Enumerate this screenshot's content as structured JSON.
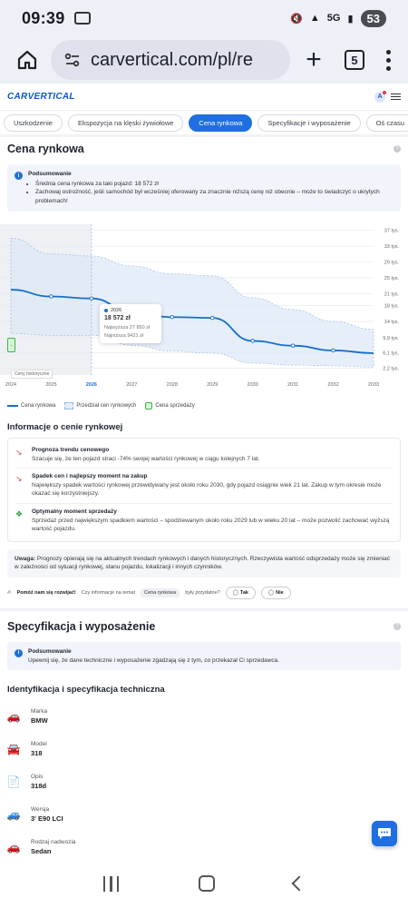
{
  "status_bar": {
    "time": "09:39",
    "network": "5G",
    "battery": "53"
  },
  "browser": {
    "url": "carvertical.com/pl/re",
    "tab_count": "5"
  },
  "site": {
    "logo_main": "CARVERTICAL",
    "avatar_initial": "A"
  },
  "tabs": [
    {
      "label": "Uszkodzenie",
      "active": false
    },
    {
      "label": "Ekspozycja na klęski żywiołowe",
      "active": false
    },
    {
      "label": "Cena rynkowa",
      "active": true
    },
    {
      "label": "Specyfikacje i wyposażenie",
      "active": false
    },
    {
      "label": "Oś czasu",
      "active": false
    }
  ],
  "market_price": {
    "title": "Cena rynkowa",
    "summary_title": "Podsumowanie",
    "summary_items": [
      "Średnia cena rynkowa za taki pojazd: 18 572 zł",
      "Zachowaj ostrożność, jeśli samochód był wcześniej oferowany za znacznie niższą cenę niż obecnie – może to świadczyć o ukrytych problemach!"
    ]
  },
  "chart_data": {
    "type": "line",
    "x": [
      2024,
      2025,
      2026,
      2027,
      2028,
      2029,
      2030,
      2031,
      2032,
      2033
    ],
    "x_ticks": [
      "2024",
      "2025",
      "2026",
      "2027",
      "2028",
      "2029",
      "2030",
      "2031",
      "2032",
      "2033"
    ],
    "y_ticks": [
      "37 tys.",
      "33 tys.",
      "29 tys.",
      "25 tys.",
      "21 tys.",
      "18 tys.",
      "14 tys.",
      "9,9 tys.",
      "6,1 tys.",
      "2,2 tys."
    ],
    "y_tick_values": [
      37,
      33,
      29,
      25,
      21,
      18,
      14,
      9.9,
      6.1,
      2.2
    ],
    "ylim": [
      0.5,
      38.5
    ],
    "series": [
      {
        "name": "Cena rynkowa",
        "values": [
          22,
          20.3,
          19.8,
          16.4,
          15.1,
          14.9,
          9.1,
          7.9,
          6.7,
          6.0
        ]
      }
    ],
    "band_upper": [
      35,
      31,
      30.5,
      28,
      26,
      25.5,
      20,
      17,
      14,
      12
    ],
    "band_lower": [
      11,
      10.5,
      10.5,
      8,
      6.5,
      6,
      3.5,
      3,
      2.8,
      2.5
    ],
    "highlight": {
      "year": "2026",
      "price": "18 572 zł",
      "max": "Najwyższa 27 850 zł",
      "min": "Najniższa 9421 zł"
    },
    "historical_label": "Ceny historyczne",
    "legend": [
      "Cena rynkowa",
      "Przedział cen rynkowych",
      "Cena sprzedaży"
    ]
  },
  "colors": {
    "accent": "#1f6fe0",
    "line": "#1470c9",
    "band": "#e3ecf8",
    "sale": "#3eb24a"
  },
  "price_info": {
    "title": "Informacje o cenie rynkowej",
    "items": [
      {
        "icon": "trend-down-icon",
        "title": "Prognoza trendu cenowego",
        "text": "Szacuje się, że ten pojazd straci -74% swojej wartości rynkowej w ciągu kolejnych 7 lat."
      },
      {
        "icon": "drop-icon",
        "title": "Spadek cen i najlepszy moment na zakup",
        "text": "Największy spadek wartości rynkowej przewidywany jest około roku 2030, gdy pojazd osiągnie wiek 21 lat. Zakup w tym okresie może okazać się korzystniejszy."
      },
      {
        "icon": "tag-icon",
        "title": "Optymalny moment sprzedaży",
        "text": "Sprzedaż przed największym spadkiem wartości – spodziewanym około roku 2029 lub w wieku 20 lat – może pozwolić zachować wyższą wartość pojazdu."
      }
    ]
  },
  "note": {
    "bold": "Uwaga:",
    "text": " Prognozy opierają się na aktualnych trendach rynkowych i danych historycznych. Rzeczywista wartość odsprzedaży może się zmieniać w zależności od sytuacji rynkowej, stanu pojazdu, lokalizacji i innych czynników."
  },
  "feedback": {
    "bold": "Pomóż nam się rozwijać!",
    "question": "Czy informacje na temat",
    "chip": "Cena rynkowa",
    "suffix": "były przydatne?",
    "yes": "Tak",
    "no": "Nie"
  },
  "specs": {
    "title": "Specyfikacja i wyposażenie",
    "summary_title": "Podsumowanie",
    "summary_text": "Upewnij się, że dane techniczne i wyposażenie zgadzają się z tym, co przekazał Ci sprzedawca.",
    "id_title": "Identyfikacja i specyfikacja techniczna",
    "rows": [
      {
        "icon": "car-brand-icon",
        "label": "Marka",
        "value": "BMW"
      },
      {
        "icon": "car-model-icon",
        "label": "Model",
        "value": "318"
      },
      {
        "icon": "document-icon",
        "label": "Opis",
        "value": "318d"
      },
      {
        "icon": "car-version-icon",
        "label": "Wersja",
        "value": "3' E90 LCI"
      },
      {
        "icon": "car-body-icon",
        "label": "Rodzaj nadwozia",
        "value": "Sedan"
      }
    ]
  }
}
